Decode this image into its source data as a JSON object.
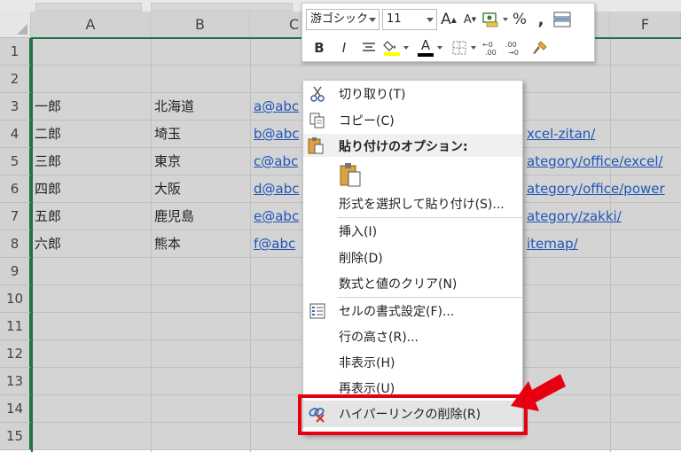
{
  "sheet": {
    "columns": [
      "A",
      "B",
      "C",
      "",
      "",
      "F"
    ],
    "rows": [
      "1",
      "2",
      "3",
      "4",
      "5",
      "6",
      "7",
      "8",
      "9",
      "10",
      "11",
      "12",
      "13",
      "14",
      "15"
    ],
    "data": [
      {
        "row": 3,
        "a": "一郎",
        "b": "北海道",
        "c": "a@abc",
        "f": ""
      },
      {
        "row": 4,
        "a": "二郎",
        "b": "埼玉",
        "c": "b@abc",
        "f": "xcel-zitan/"
      },
      {
        "row": 5,
        "a": "三郎",
        "b": "東京",
        "c": "c@abc",
        "f": "ategory/office/excel/"
      },
      {
        "row": 6,
        "a": "四郎",
        "b": "大阪",
        "c": "d@abc",
        "f": "ategory/office/power"
      },
      {
        "row": 7,
        "a": "五郎",
        "b": "鹿児島",
        "c": "e@abc",
        "f": "ategory/zakki/"
      },
      {
        "row": 8,
        "a": "六郎",
        "b": "熊本",
        "c": "f@abc",
        "f": "itemap/"
      }
    ]
  },
  "mini_toolbar": {
    "font_name": "游ゴシック",
    "font_size": "11",
    "grow_label": "A",
    "shrink_label": "A",
    "percent_label": "%",
    "comma_label": ",",
    "bold_label": "B",
    "italic_label": "I",
    "font_color_label": "A",
    "font_color": "#000000",
    "fill_color": "#ffff00"
  },
  "context_menu": {
    "items": {
      "cut": "切り取り(T)",
      "copy": "コピー(C)",
      "paste_options": "貼り付けのオプション:",
      "paste_special": "形式を選択して貼り付け(S)...",
      "insert": "挿入(I)",
      "delete": "削除(D)",
      "clear_contents": "数式と値のクリア(N)",
      "format_cells": "セルの書式設定(F)...",
      "row_height": "行の高さ(R)...",
      "hide": "非表示(H)",
      "unhide": "再表示(U)",
      "remove_hyperlinks": "ハイパーリンクの削除(R)"
    }
  },
  "colors": {
    "highlight_red": "#e60012",
    "excel_green": "#217346",
    "link_blue": "#1f55b8"
  }
}
